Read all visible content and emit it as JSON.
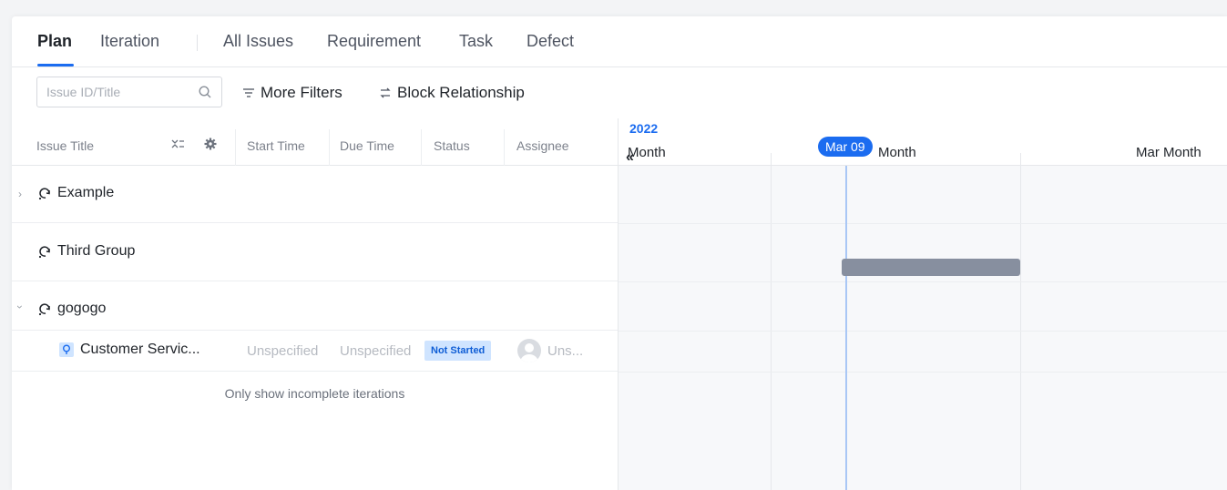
{
  "tabs": [
    {
      "label": "Plan",
      "active": true
    },
    {
      "label": "Iteration"
    },
    {
      "label": "All Issues"
    },
    {
      "label": "Requirement"
    },
    {
      "label": "Task"
    },
    {
      "label": "Defect"
    }
  ],
  "toolbar": {
    "search_placeholder": "Issue ID/Title",
    "more_filters": "More Filters",
    "block_relationship": "Block Relationship"
  },
  "columns": {
    "issue_title": "Issue Title",
    "start_time": "Start Time",
    "due_time": "Due Time",
    "status": "Status",
    "assignee": "Assignee"
  },
  "rows": [
    {
      "label": "Example",
      "expandable": true,
      "expanded": false
    },
    {
      "label": "Third Group",
      "expandable": false
    },
    {
      "label": "gogogo",
      "expandable": true,
      "expanded": true
    }
  ],
  "child_row": {
    "label": "Customer Servic...",
    "start": "Unspecified",
    "due": "Unspecified",
    "status": "Not Started",
    "assignee": "Uns..."
  },
  "footnote": "Only show incomplete iterations",
  "gantt": {
    "year": "2022",
    "months": [
      "Month",
      "Month",
      "Mar Month"
    ],
    "today": "Mar 09",
    "collapse_glyph": "«"
  },
  "colors": {
    "accent": "#1b6cf0",
    "bar": "#878f9f",
    "badge_bg": "#cfe4ff"
  }
}
